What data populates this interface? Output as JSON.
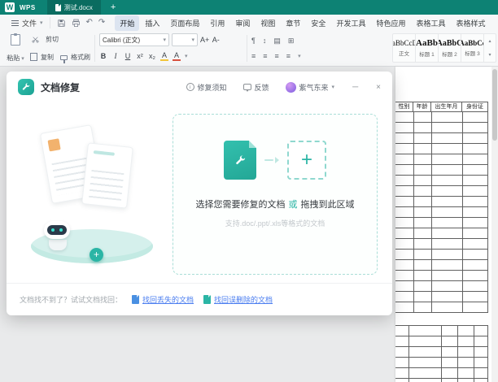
{
  "colors": {
    "titlebar_teal": "#0d8274",
    "doc_tab_teal": "#0a6c60",
    "accent_teal": "#2bb5a5",
    "active_tab_bg": "#dce4f0",
    "link_blue": "#4a7df0",
    "dashed_border": "#a9ded7"
  },
  "icons": {
    "plus": "+",
    "dropdown": "▾",
    "caret_small": "▾",
    "undo": "↶",
    "redo": "↷",
    "minimize": "─",
    "close": "×",
    "scroll_up": "▴",
    "scroll_down": "▾",
    "align": "≡",
    "border_grid": "⊞",
    "shading": "▤",
    "spacing": "↕",
    "pilcrow": "¶",
    "info": "i",
    "wps_logo_letter": "W"
  },
  "titlebar": {
    "brand": "WPS",
    "document_tab": "测试.docx"
  },
  "menubar": {
    "file_menu": "文件",
    "active_tab": "开始",
    "tabs": [
      "开始",
      "插入",
      "页面布局",
      "引用",
      "审阅",
      "视图",
      "章节",
      "安全",
      "开发工具",
      "特色应用",
      "表格工具",
      "表格样式"
    ]
  },
  "ribbon": {
    "paste": "粘贴",
    "cut": "剪切",
    "copy": "复制",
    "format_painter": "格式刷",
    "font_name": "Calibri (正文)",
    "format_buttons": {
      "bold": "B",
      "italic": "I",
      "underline": "U",
      "grow": "A+",
      "shrink": "A-",
      "superscript": "x²",
      "subscript": "x₂",
      "highlight": "A",
      "font_color": "A"
    },
    "styles": [
      {
        "preview": "AaBbCcDd",
        "label": "正文"
      },
      {
        "preview": "AaBb",
        "label": "标题 1"
      },
      {
        "preview": "AaBbC",
        "label": "标题 2"
      },
      {
        "preview": "AaBbCc",
        "label": "标题 3"
      }
    ]
  },
  "dialog": {
    "title": "文档修复",
    "repair_notice": "修复须知",
    "feedback": "反馈",
    "username": "紫气东来",
    "drop_main_1": "选择您需要修复的文档",
    "drop_or": "或",
    "drop_main_2": "拖拽到此区域",
    "drop_sub": "支持.doc/.ppt/.xls等格式的文档",
    "footer_hint": "文档找不到了？试试文档找回：",
    "link_lost": "找回丢失的文档",
    "link_deleted": "找回误删除的文档"
  },
  "document_page": {
    "table_headers": [
      "性别",
      "年龄",
      "出生年月",
      "身份证"
    ]
  }
}
